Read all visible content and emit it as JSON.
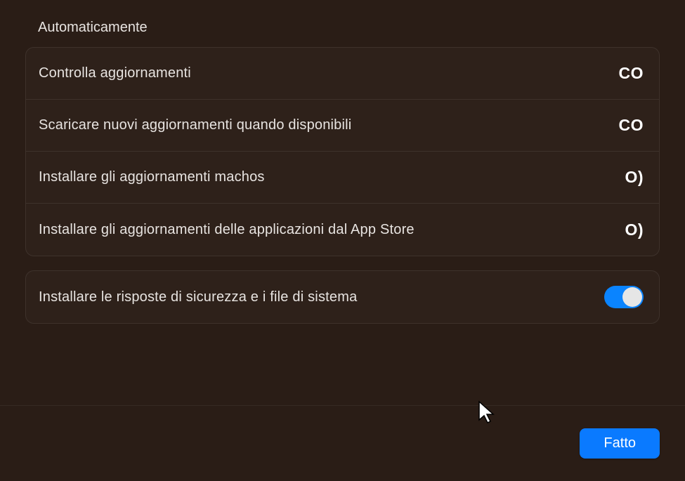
{
  "section_title": "Automaticamente",
  "group1": {
    "items": [
      {
        "label": "Controlla aggiornamenti",
        "value": "CO"
      },
      {
        "label": "Scaricare nuovi aggiornamenti quando disponibili",
        "value": "CO"
      },
      {
        "label": "Installare gli aggiornamenti machos",
        "value": "O)"
      },
      {
        "label": "Installare gli aggiornamenti delle applicazioni dal App Store",
        "value": "O)"
      }
    ]
  },
  "group2": {
    "items": [
      {
        "label": "Installare le risposte di sicurezza e i file di sistema",
        "toggle": true
      }
    ]
  },
  "footer": {
    "done_label": "Fatto"
  }
}
